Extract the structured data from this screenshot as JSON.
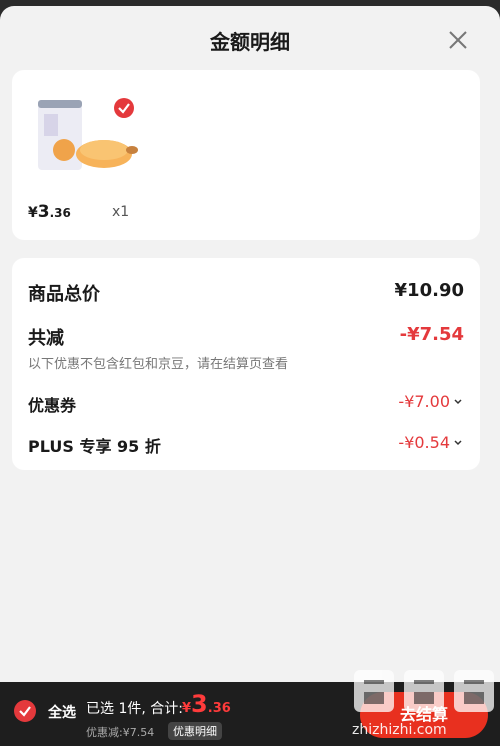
{
  "sheet": {
    "title": "金额明细"
  },
  "product": {
    "price_symbol": "¥",
    "price_int": "3",
    "price_dec": ".36",
    "quantity": "x1",
    "checked": true
  },
  "summary": {
    "total_label": "商品总价",
    "total_value": "¥10.90",
    "reduce_label": "共减",
    "reduce_value": "-¥7.54",
    "note": "以下优惠不包含红包和京豆，请在结算页查看",
    "coupon_label": "优惠券",
    "coupon_value": "-¥7.00",
    "plus_label": "PLUS 专享 95 折",
    "plus_value": "-¥0.54"
  },
  "bottom_bar": {
    "select_all_label": "全选",
    "selected_text": "已选 1件, 合计:",
    "total_symbol": "¥",
    "total_int": "3",
    "total_dec": ".36",
    "discount_text": "优惠减:¥7.54",
    "detail_tag": "优惠明细",
    "checkout_label": "去结算"
  },
  "watermark": {
    "text": "zhizhizhi.com"
  },
  "colors": {
    "accent_red": "#e4393c",
    "checkout_red": "#e8301f"
  },
  "icons": {
    "close": "close-icon",
    "check": "check-circle-icon",
    "chevron": "chevron-down-icon"
  }
}
